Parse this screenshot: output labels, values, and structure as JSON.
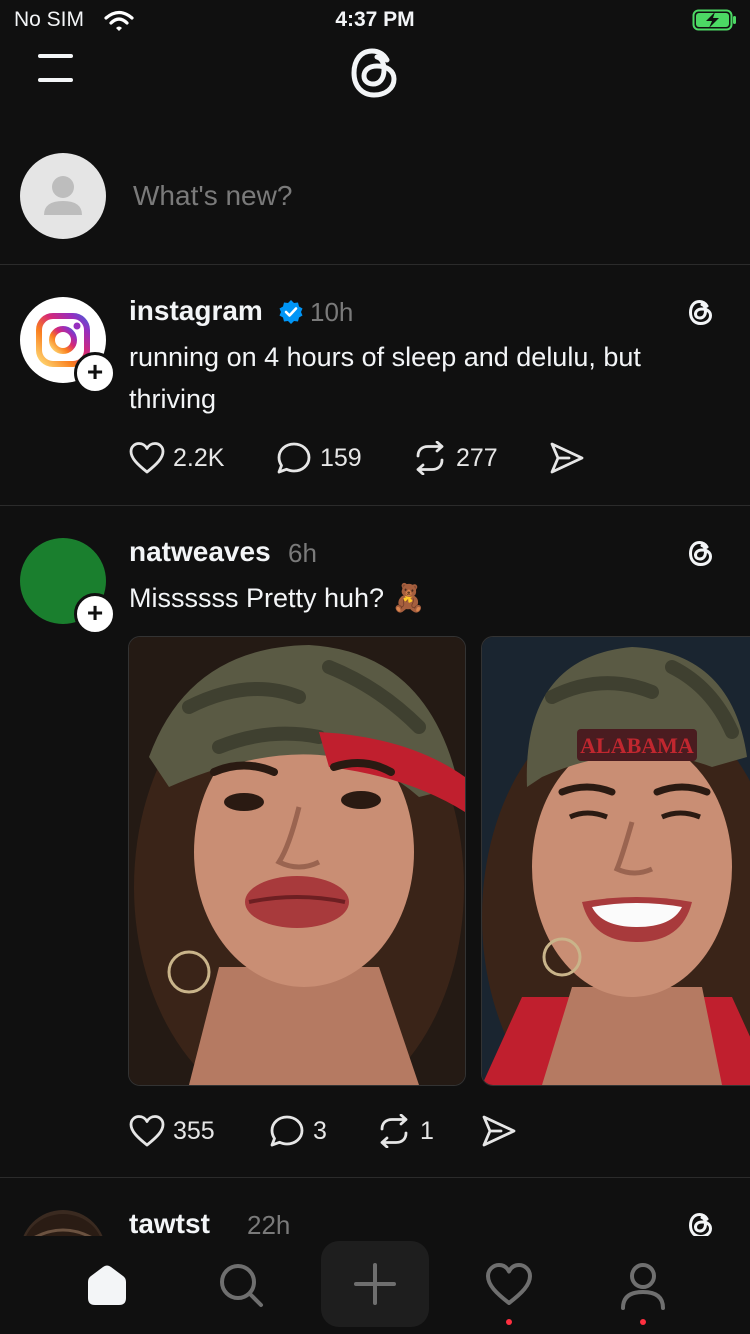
{
  "status": {
    "carrier": "No SIM",
    "time": "4:37 PM"
  },
  "composer": {
    "placeholder": "What's new?"
  },
  "posts": [
    {
      "username": "instagram",
      "verified": true,
      "time": "10h",
      "text": "running on 4 hours of sleep and delulu, but thriving",
      "likes": "2.2K",
      "replies": "159",
      "reposts": "277"
    },
    {
      "username": "natweaves",
      "time": "6h",
      "text": "Missssss Pretty huh? 🧸",
      "likes": "355",
      "replies": "3",
      "reposts": "1",
      "photos": [
        "selfie-in-camo-cap",
        "smiling-selfie-alabama-cap"
      ],
      "cap_text": "ALABAMA"
    },
    {
      "username": "tawtst",
      "time": "22h"
    }
  ],
  "icons": {
    "menu": "menu-icon",
    "logo": "threads-logo",
    "home": "home-icon",
    "search": "search-icon",
    "compose": "plus-icon",
    "activity": "heart-icon",
    "profile": "profile-icon"
  },
  "colors": {
    "background": "#101010",
    "verified": "#0095f6",
    "notification_dot": "#ff3040",
    "avatar_green": "#1a7f2e"
  }
}
